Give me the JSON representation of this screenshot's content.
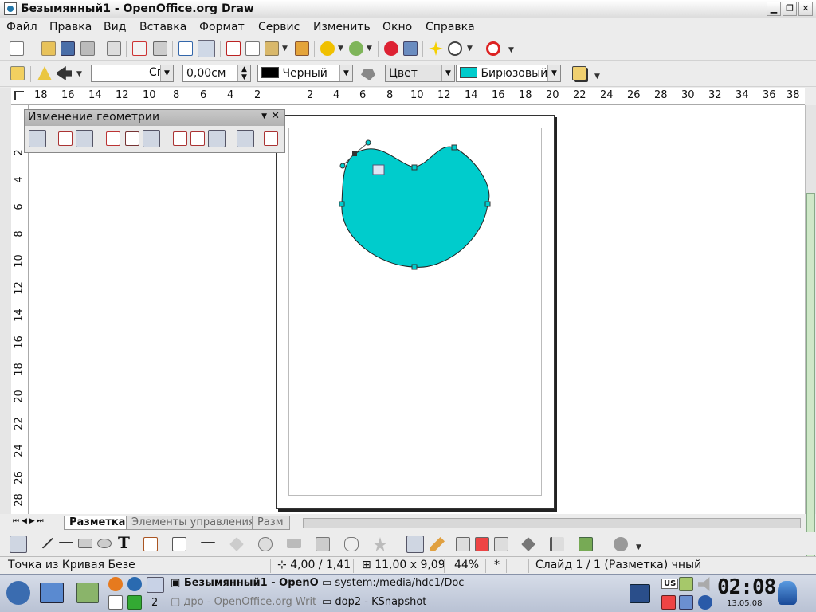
{
  "window": {
    "title": "Безымянный1 - OpenOffice.org Draw",
    "min": "▁",
    "max": "❐",
    "close": "✕"
  },
  "menu": [
    "Файл",
    "Правка",
    "Вид",
    "Вставка",
    "Формат",
    "Сервис",
    "Изменить",
    "Окно",
    "Справка"
  ],
  "linebar": {
    "line_style": "Сп",
    "line_width": "0,00см",
    "line_color": "Черный",
    "area_style": "Цвет",
    "area_color": "Бирюзовый",
    "line_color_hex": "#000000",
    "area_color_hex": "#00cccc"
  },
  "hruler": [
    "18",
    "16",
    "14",
    "12",
    "10",
    "8",
    "6",
    "4",
    "2",
    "2",
    "4",
    "6",
    "8",
    "10",
    "12",
    "14",
    "16",
    "18",
    "20",
    "22",
    "24",
    "26",
    "28",
    "30",
    "32",
    "34",
    "36",
    "38"
  ],
  "vruler": [
    "2",
    "4",
    "6",
    "8",
    "10",
    "12",
    "14",
    "16",
    "18",
    "20",
    "22",
    "24",
    "26",
    "28"
  ],
  "geometry_toolbar": {
    "title": "Изменение геометрии"
  },
  "tabs": [
    "Разметка",
    "Элементы управления",
    "Разм"
  ],
  "status": {
    "mode": "Точка из Кривая Безе",
    "position": "4,00 / 1,41",
    "size": "11,00 x 9,09",
    "zoom": "44%",
    "modified": "*",
    "slide": "Слайд 1 / 1 (Разметка) чный"
  },
  "taskbar": {
    "tasks": [
      "Безымянный1 - OpenO",
      "system:/media/hdc1/Doc",
      "дро - OpenOffice.org Writ",
      "dop2 - KSnapshot"
    ],
    "desktop_num": "2",
    "kb_layout": "US",
    "clock": "02:08",
    "date": "13.05.08"
  },
  "shape_fill": "#00cccc"
}
